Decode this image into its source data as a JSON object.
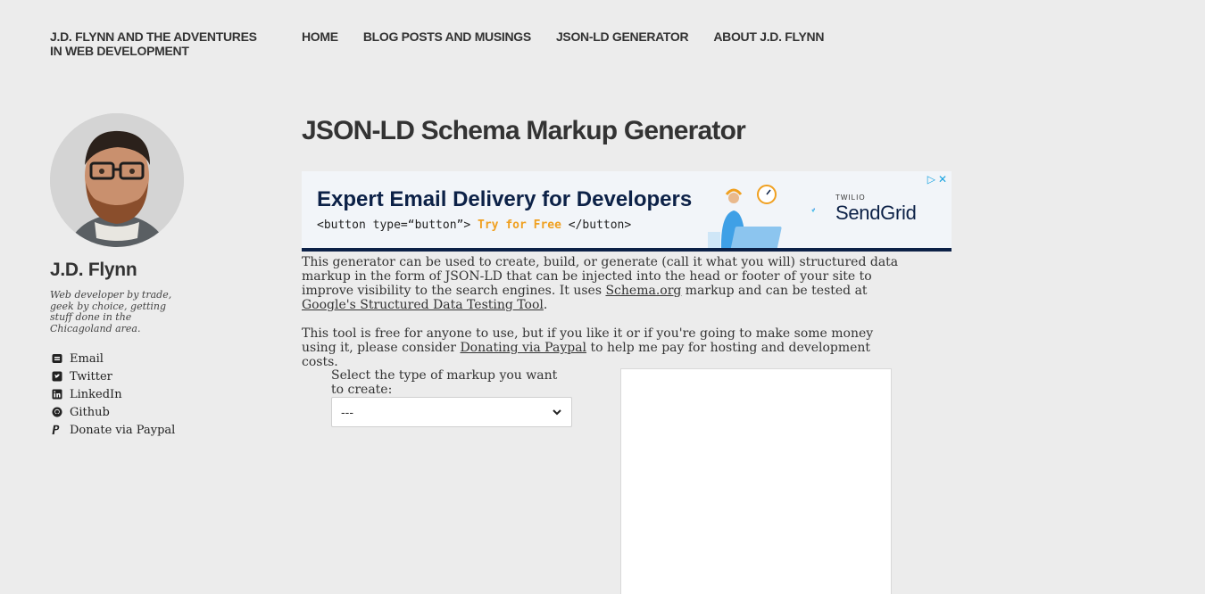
{
  "header": {
    "site_title": "J.D. FLYNN AND THE ADVENTURES IN WEB DEVELOPMENT",
    "nav": [
      "HOME",
      "BLOG POSTS AND MUSINGS",
      "JSON-LD GENERATOR",
      "ABOUT J.D. FLYNN"
    ]
  },
  "sidebar": {
    "name": "J.D. Flynn",
    "bio": "Web developer by trade, geek by choice, getting stuff done in the Chicagoland area.",
    "links": [
      {
        "label": "Email",
        "icon": "email-icon"
      },
      {
        "label": "Twitter",
        "icon": "twitter-icon"
      },
      {
        "label": "LinkedIn",
        "icon": "linkedin-icon"
      },
      {
        "label": "Github",
        "icon": "github-icon"
      },
      {
        "label": "Donate via Paypal",
        "icon": "paypal-icon"
      }
    ]
  },
  "main": {
    "title": "JSON-LD Schema Markup Generator",
    "ad": {
      "headline": "Expert Email Delivery for Developers",
      "code_before": "<button type=“button”>",
      "code_cta": "Try for Free",
      "code_after": "</button>",
      "brand_small": "TWILIO",
      "brand": "SendGrid",
      "accent_color": "#f0a020",
      "navy_color": "#0c2147"
    },
    "intro1_a": "This generator can be used to create, build, or generate (call it what you will) structured data markup in the form of JSON-LD that can be injected into the head or footer of your site to improve visibility to the search engines. It uses ",
    "intro1_link1": "Schema.org",
    "intro1_b": " markup and can be tested at ",
    "intro1_link2": "Google's Structured Data Testing Tool",
    "intro1_c": ".",
    "intro2_a": "This tool is free for anyone to use, but if you like it or if you're going to make some money using it, please consider ",
    "intro2_link": "Donating via Paypal",
    "intro2_b": " to help me pay for hosting and development costs.",
    "select_label": "Select the type of markup you want to create:",
    "select_value": "---"
  }
}
